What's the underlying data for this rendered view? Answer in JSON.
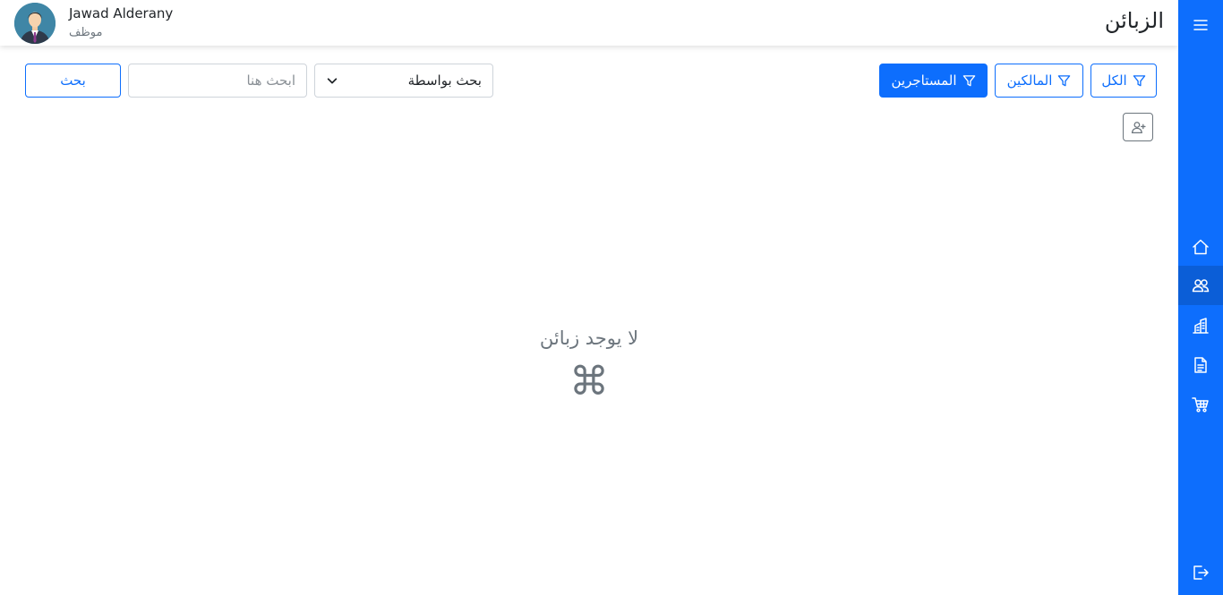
{
  "header": {
    "title": "الزبائن",
    "user_name": "Jawad Alderany",
    "user_role": "موظف"
  },
  "filters": {
    "all_label": "الكل",
    "owners_label": "المالكين",
    "tenants_label": "المستاجرين"
  },
  "search": {
    "select_label": "بحث بواسطة",
    "placeholder": "ابحث هنا",
    "button_label": "بحث"
  },
  "empty_state": {
    "message": "لا يوجد زبائن",
    "icon": "⌘"
  },
  "sidebar": {
    "items": [
      {
        "icon": "menu-icon"
      },
      {
        "icon": "home-icon"
      },
      {
        "icon": "people-icon",
        "active": true
      },
      {
        "icon": "buildings-icon"
      },
      {
        "icon": "file-text-icon"
      },
      {
        "icon": "cart-icon"
      },
      {
        "icon": "logout-icon"
      }
    ]
  },
  "colors": {
    "primary": "#0d6efd",
    "active_sidebar": "#0b5ed7",
    "muted": "#6c757d"
  }
}
